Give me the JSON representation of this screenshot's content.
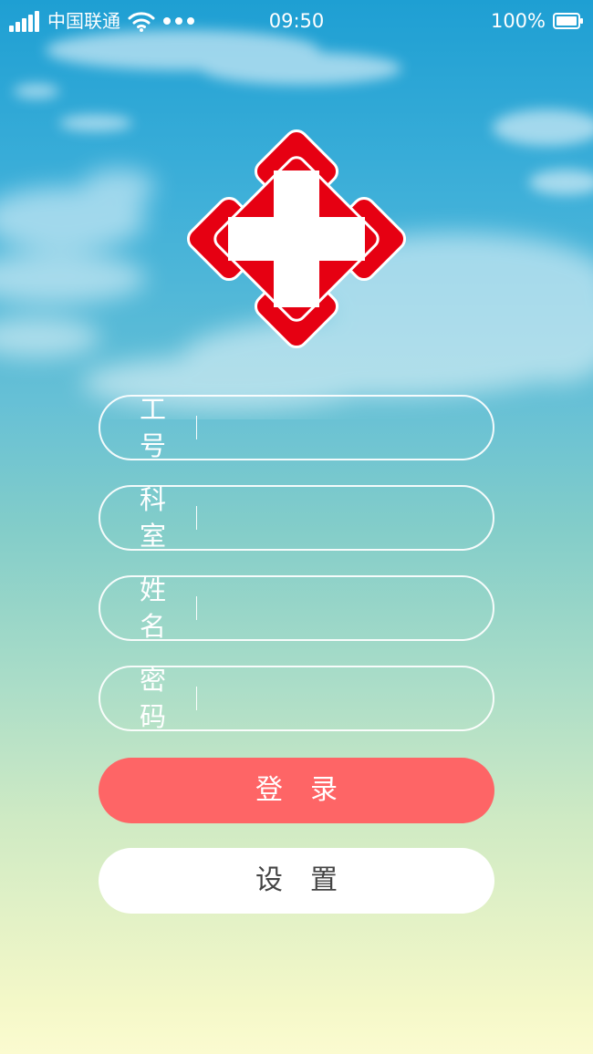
{
  "status_bar": {
    "carrier": "中国联通",
    "time": "09:50",
    "battery": "100%",
    "icons": [
      "signal-icon",
      "wifi-icon",
      "more-dots-icon",
      "battery-icon"
    ]
  },
  "logo": {
    "icon": "red-cross-icon",
    "colors": {
      "primary": "#e60012",
      "secondary": "#ffffff"
    }
  },
  "form": {
    "fields": [
      {
        "label": "工号",
        "value": ""
      },
      {
        "label": "科室",
        "value": ""
      },
      {
        "label": "姓名",
        "value": ""
      },
      {
        "label": "密码",
        "value": ""
      }
    ]
  },
  "buttons": {
    "login_label": "登录",
    "settings_label": "设置"
  },
  "colors": {
    "login_button": "#fe6566",
    "settings_button": "#ffffff",
    "settings_text": "#444444"
  }
}
